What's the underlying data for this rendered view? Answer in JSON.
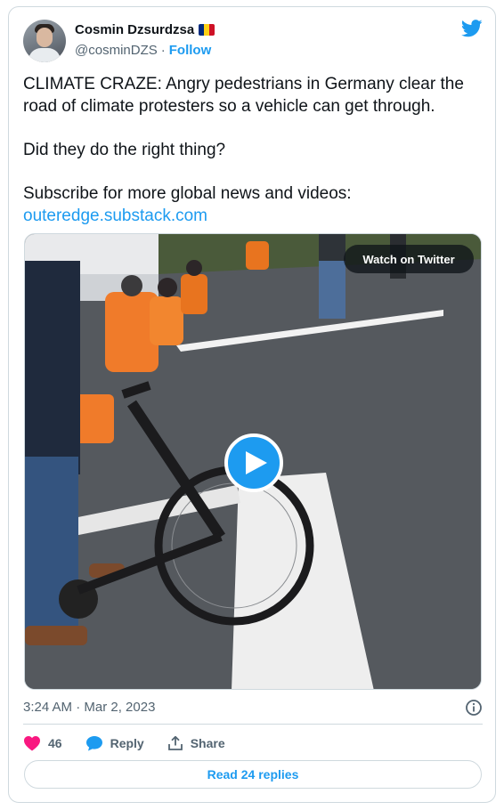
{
  "author": {
    "display_name": "Cosmin Dzsurdzsa",
    "handle": "@cosminDZS",
    "separator": "·",
    "follow_label": "Follow",
    "flag_colors": [
      "#002B7F",
      "#FCD116",
      "#CE1126"
    ]
  },
  "tweet": {
    "paragraph_1": "CLIMATE CRAZE: Angry pedestrians in Germany clear the road of climate protesters so a vehicle can get through.",
    "paragraph_2": "Did they do the right thing?",
    "paragraph_3": "Subscribe for more global news and videos:",
    "link": "outeredge.substack.com"
  },
  "media": {
    "watch_label": "Watch on Twitter",
    "play_icon": "play-icon"
  },
  "meta": {
    "timestamp": "3:24 AM · Mar 2, 2023"
  },
  "actions": {
    "like_count": "46",
    "reply_label": "Reply",
    "share_label": "Share"
  },
  "footer": {
    "read_replies_label": "Read 24 replies"
  },
  "colors": {
    "accent": "#1d9bf0",
    "like": "#f91880",
    "muted": "#536471",
    "border": "#cfd9de"
  }
}
